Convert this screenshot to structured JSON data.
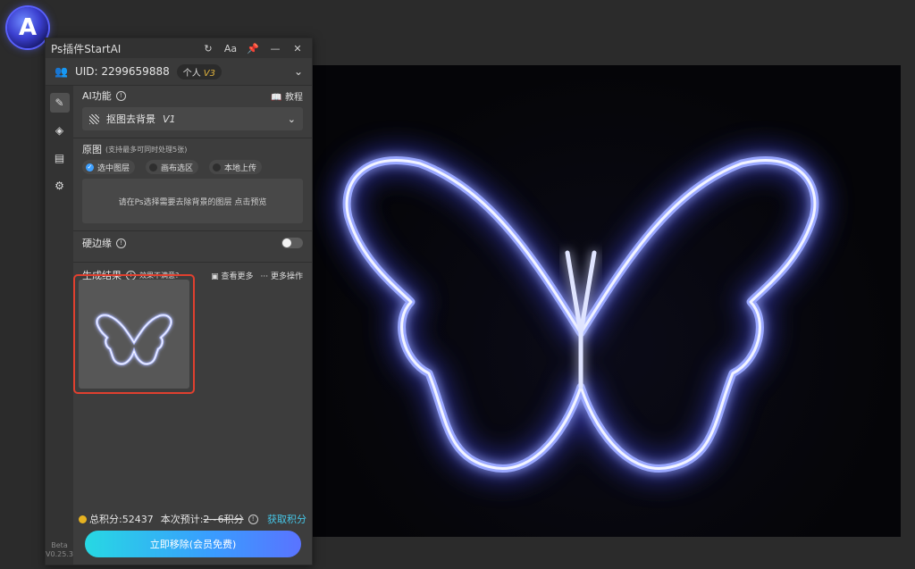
{
  "window": {
    "title": "Ps插件StartAI"
  },
  "titlebar": {
    "icons": [
      "refresh-icon",
      "font-size-icon",
      "pin-icon",
      "minimize-icon",
      "close-icon"
    ],
    "font_label": "Aa"
  },
  "user": {
    "uid": "UID: 2299659888",
    "plan": "个人",
    "plan_version": "V3"
  },
  "sidebar": {
    "items": [
      "brush-icon",
      "layers-icon",
      "save-icon",
      "gear-icon"
    ],
    "beta": "Beta",
    "version": "V0.25.3"
  },
  "ai_function": {
    "label": "AI功能",
    "tutorial": "教程",
    "selected": "抠图去背景",
    "selected_version": "V1"
  },
  "source": {
    "label": "原图",
    "note": "(支持最多可同时处理5张)",
    "options": [
      "选中图层",
      "画布选区",
      "本地上传"
    ],
    "selected_index": 0,
    "dropzone_text": "请在Ps选择需要去除背景的图层 点击预览"
  },
  "hard_edge": {
    "label": "硬边缘",
    "enabled": false
  },
  "results": {
    "label": "生成结果",
    "note": "效果不满意?",
    "view_more": "查看更多",
    "more_actions": "更多操作"
  },
  "footer": {
    "total_points": "总积分:52437",
    "estimate_label": "本次预计:",
    "estimate_value": "2~6积分",
    "get_points": "获取积分",
    "cta": "立即移除(会员免费)"
  },
  "colors": {
    "accent": "#3ea0ff",
    "highlight_border": "#e0402f",
    "link": "#46c7e8",
    "coin": "#e6b221"
  }
}
